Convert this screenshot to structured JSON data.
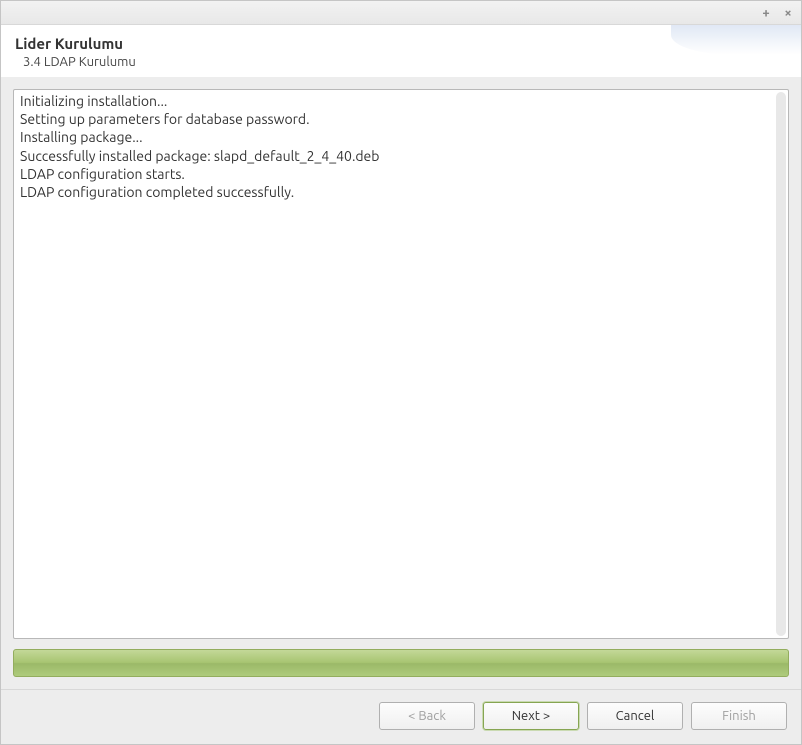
{
  "titlebar": {
    "plus_label": "+",
    "close_label": "×"
  },
  "header": {
    "title": "Lider Kurulumu",
    "subtitle": "3.4 LDAP Kurulumu"
  },
  "log": {
    "lines": "Initializing installation...\nSetting up parameters for database password.\nInstalling package...\nSuccessfully installed package: slapd_default_2_4_40.deb\nLDAP configuration starts.\nLDAP configuration completed successfully."
  },
  "progress": {
    "percent": 100
  },
  "buttons": {
    "back": "< Back",
    "next": "Next >",
    "cancel": "Cancel",
    "finish": "Finish"
  }
}
